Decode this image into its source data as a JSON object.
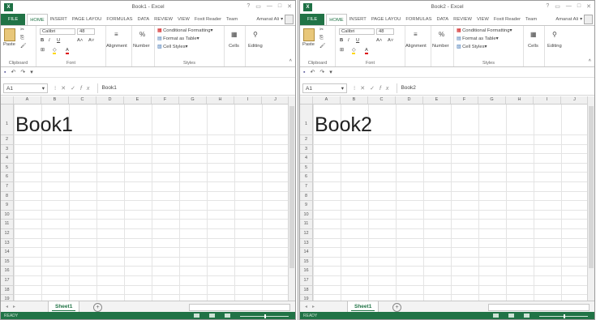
{
  "colors": {
    "excel_green": "#217346",
    "file_tab": "#217346",
    "status_bar": "#217346"
  },
  "windows": [
    {
      "title": "Book1 - Excel",
      "window_controls": [
        "?",
        "▭",
        "—",
        "□",
        "✕"
      ],
      "tabs": [
        "FILE",
        "HOME",
        "INSERT",
        "PAGE LAYOU",
        "FORMULAS",
        "DATA",
        "REVIEW",
        "VIEW",
        "Foxit Reader",
        "Team"
      ],
      "account": "Amanat Ali",
      "ribbon": {
        "clipboard_label": "Clipboard",
        "paste": "Paste",
        "font_label": "Font",
        "font_name": "Calibri",
        "font_size": "48",
        "alignment": "Alignment",
        "number": "Number",
        "conditional": "Conditional Formatting",
        "format_table": "Format as Table",
        "cell_styles": "Cell Styles",
        "styles_label": "Styles",
        "cells": "Cells",
        "editing": "Editing"
      },
      "namebox": "A1",
      "formula": "Book1",
      "columns": [
        "A",
        "B",
        "C",
        "D",
        "E",
        "F",
        "G",
        "H",
        "I",
        "J"
      ],
      "rows": [
        "1",
        "2",
        "3",
        "4",
        "5",
        "6",
        "7",
        "8",
        "9",
        "10",
        "11",
        "12",
        "13",
        "14",
        "15",
        "16",
        "17",
        "18",
        "19"
      ],
      "cell_a1": "Book1",
      "sheet_tab": "Sheet1",
      "add_sheet": "+",
      "status": "READY"
    },
    {
      "title": "Book2 - Excel",
      "window_controls": [
        "?",
        "▭",
        "—",
        "□",
        "✕"
      ],
      "tabs": [
        "FILE",
        "HOME",
        "INSERT",
        "PAGE LAYOU",
        "FORMULAS",
        "DATA",
        "REVIEW",
        "VIEW",
        "Foxit Reader",
        "Team"
      ],
      "account": "Amanat Ali",
      "ribbon": {
        "clipboard_label": "Clipboard",
        "paste": "Paste",
        "font_label": "Font",
        "font_name": "Calibri",
        "font_size": "48",
        "alignment": "Alignment",
        "number": "Number",
        "conditional": "Conditional Formatting",
        "format_table": "Format as Table",
        "cell_styles": "Cell Styles",
        "styles_label": "Styles",
        "cells": "Cells",
        "editing": "Editing"
      },
      "namebox": "A1",
      "formula": "Book2",
      "columns": [
        "A",
        "B",
        "C",
        "D",
        "E",
        "F",
        "G",
        "H",
        "I",
        "J"
      ],
      "rows": [
        "1",
        "2",
        "3",
        "4",
        "5",
        "6",
        "7",
        "8",
        "9",
        "10",
        "11",
        "12",
        "13",
        "14",
        "15",
        "16",
        "17",
        "18",
        "19"
      ],
      "cell_a1": "Book2",
      "sheet_tab": "Sheet1",
      "add_sheet": "+",
      "status": "READY"
    }
  ]
}
